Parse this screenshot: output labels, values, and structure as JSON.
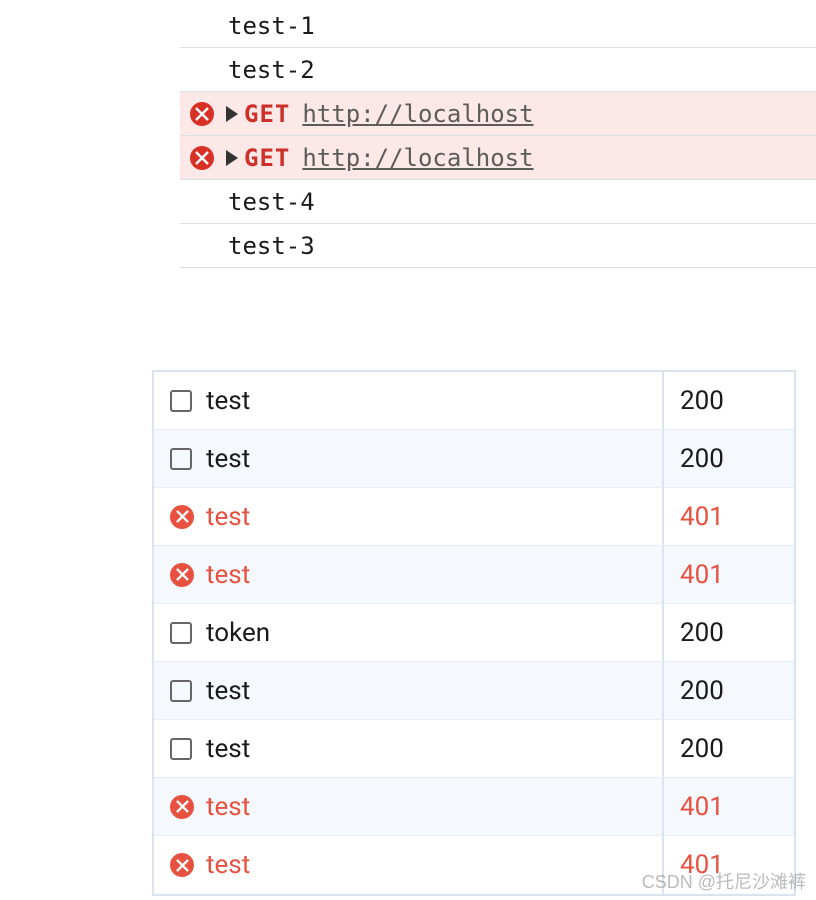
{
  "console": {
    "logs": [
      {
        "type": "plain",
        "text": "test-1"
      },
      {
        "type": "plain",
        "text": "test-2"
      },
      {
        "type": "error",
        "method": "GET",
        "url": "http://localhost"
      },
      {
        "type": "error",
        "method": "GET",
        "url": "http://localhost"
      },
      {
        "type": "plain",
        "text": "test-4"
      },
      {
        "type": "plain",
        "text": "test-3"
      }
    ]
  },
  "network": {
    "rows": [
      {
        "name": "test",
        "status": "200",
        "error": false
      },
      {
        "name": "test",
        "status": "200",
        "error": false
      },
      {
        "name": "test",
        "status": "401",
        "error": true
      },
      {
        "name": "test",
        "status": "401",
        "error": true
      },
      {
        "name": "token",
        "status": "200",
        "error": false
      },
      {
        "name": "test",
        "status": "200",
        "error": false
      },
      {
        "name": "test",
        "status": "200",
        "error": false
      },
      {
        "name": "test",
        "status": "401",
        "error": true
      },
      {
        "name": "test",
        "status": "401",
        "error": true
      }
    ]
  },
  "watermark": "CSDN @托尼沙滩裤"
}
